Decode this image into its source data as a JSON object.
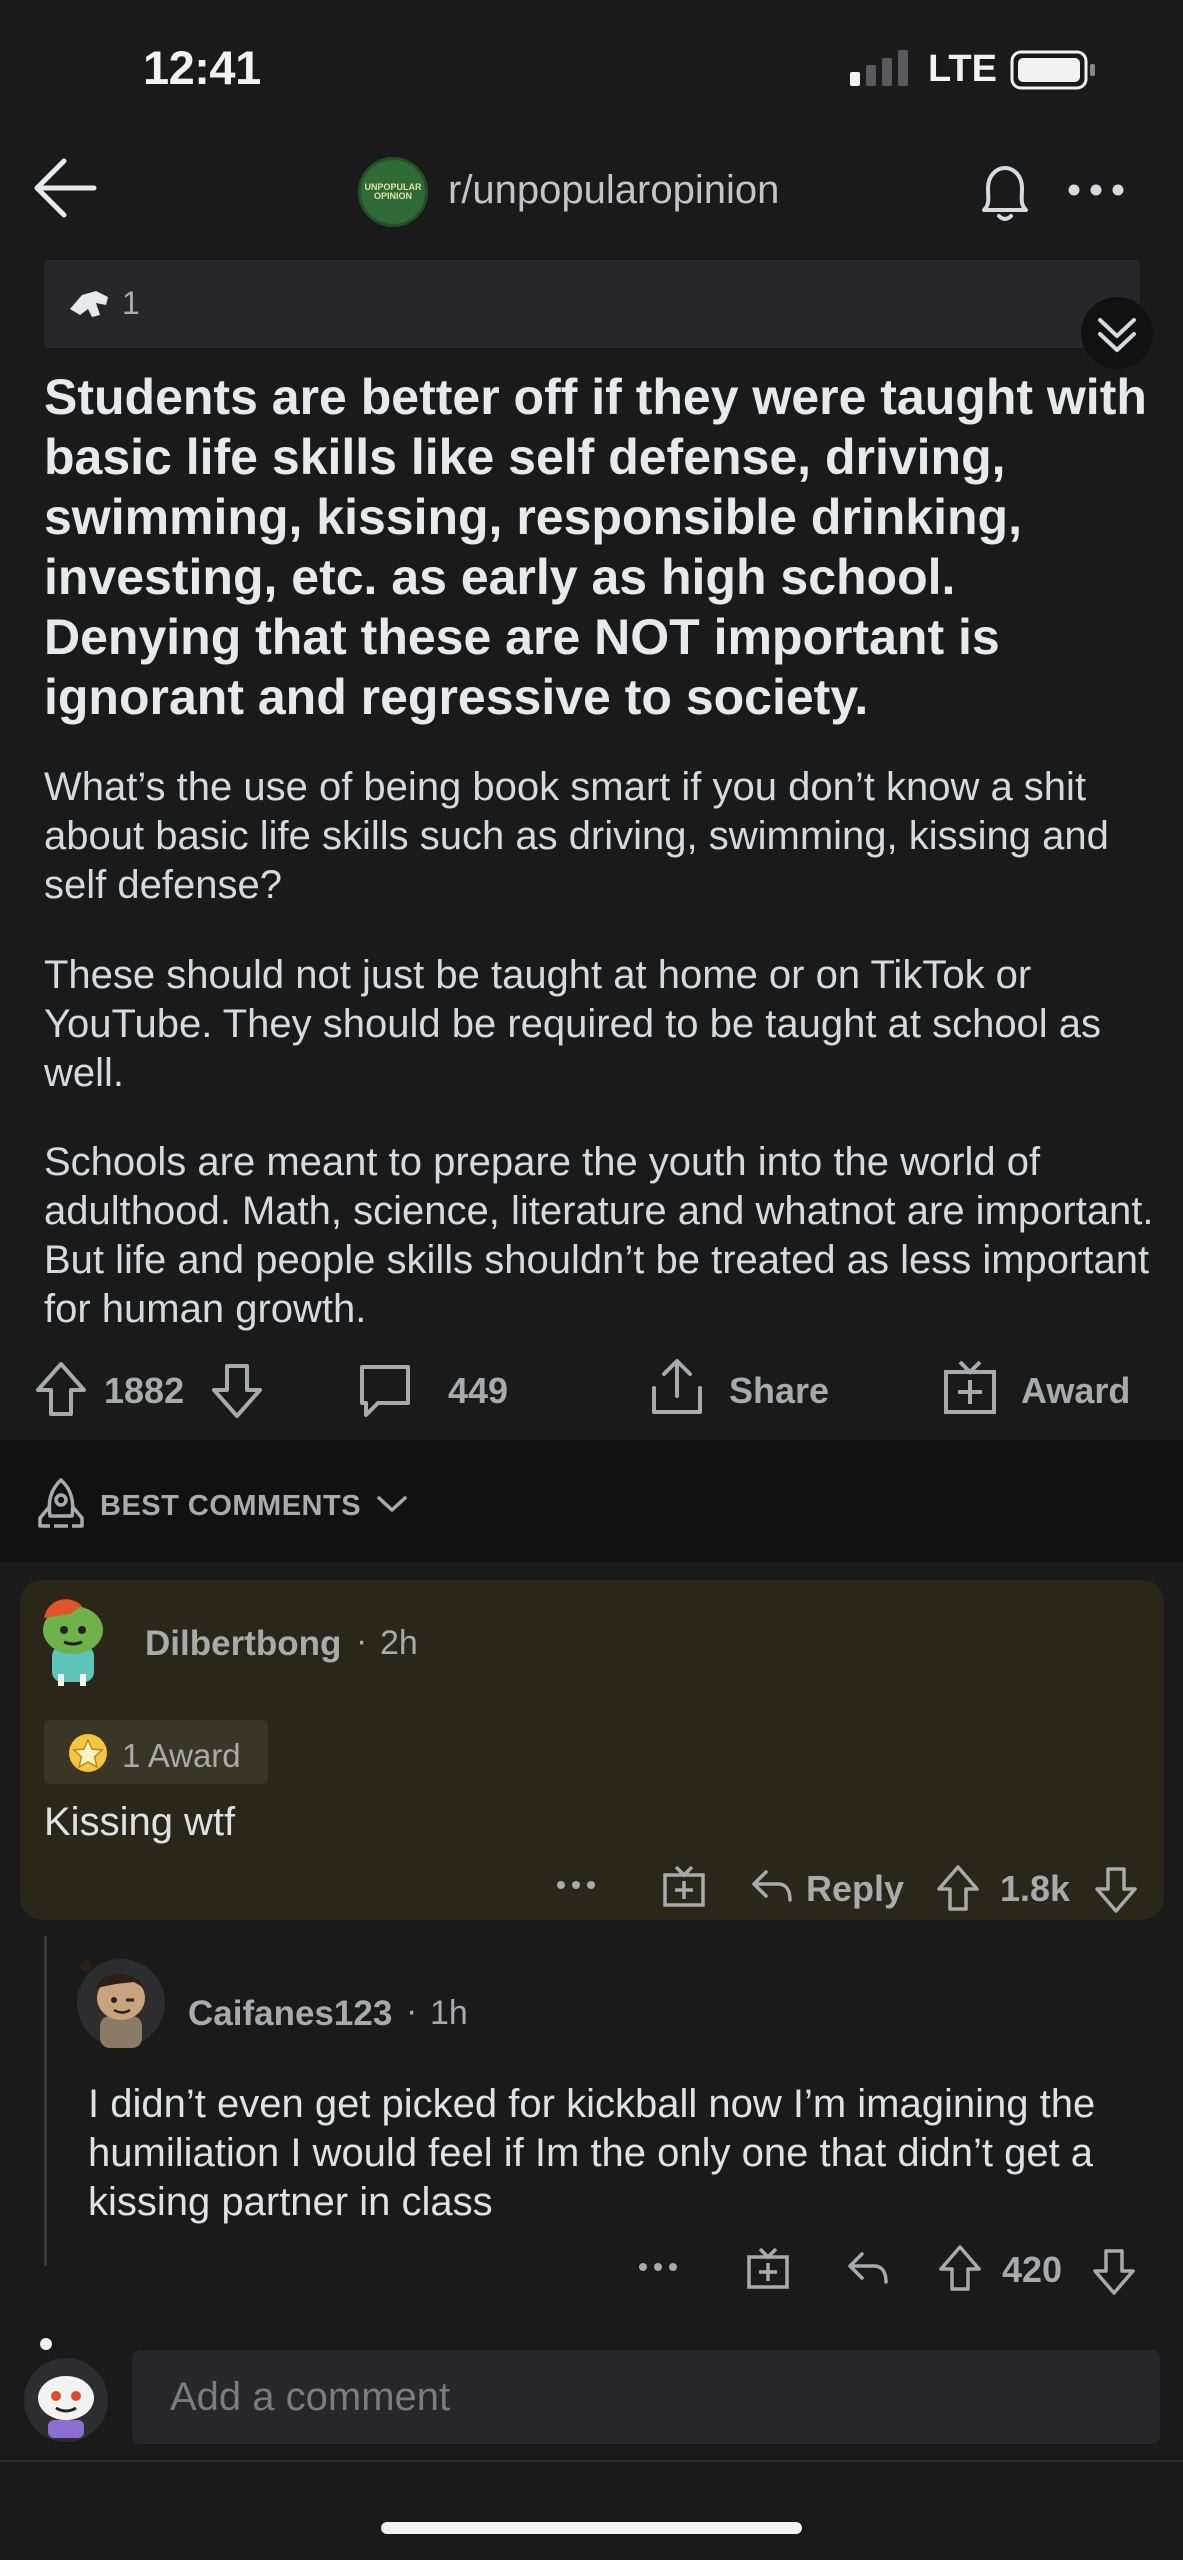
{
  "status_bar": {
    "time": "12:41",
    "network": "LTE"
  },
  "header": {
    "subreddit": "r/unpopularopinion",
    "avatar_text": "UNPOPULAR OPINION"
  },
  "post": {
    "award_count": "1",
    "title": "Students are better off if they were taught with basic life skills like self defense, driving, swimming, kissing, responsible drinking, investing, etc. as early as high school. Denying that these are NOT important is ignorant and regressive to society.",
    "body": [
      "What’s the use of being book smart if you don’t know a shit about basic life skills such as driving, swimming, kissing and self defense?",
      "These should not just be taught at home or on TikTok or YouTube. They should be required to be taught at school as well.",
      "Schools are meant to prepare the youth into the world of adulthood. Math, science, literature and whatnot are important. But life and people skills shouldn’t be treated as less important for human growth."
    ],
    "votes": "1882",
    "comments": "449",
    "share_label": "Share",
    "award_label": "Award"
  },
  "sort": {
    "label": "BEST COMMENTS"
  },
  "comments": [
    {
      "username": "Dilbertbong",
      "age": "2h",
      "award": "1 Award",
      "text": "Kissing wtf",
      "reply_label": "Reply",
      "votes": "1.8k"
    },
    {
      "username": "Caifanes123",
      "age": "1h",
      "text": "I didn’t even get picked for kickball now I’m imagining the humiliation I would feel if Im the only one that didn’t get a kissing partner in class",
      "votes": "420"
    }
  ],
  "composer": {
    "placeholder": "Add a comment"
  },
  "colors": {
    "background": "#1a1a1b",
    "highlight_card": "#2a2618",
    "text": "#d7dadc",
    "muted": "#a8aaab"
  },
  "icons": [
    "back-arrow-icon",
    "bell-icon",
    "more-icon",
    "collapse-icon",
    "upvote-icon",
    "downvote-icon",
    "comment-icon",
    "share-icon",
    "award-gift-icon",
    "rocket-icon",
    "chevron-down-icon",
    "reply-icon",
    "star-award-icon"
  ]
}
